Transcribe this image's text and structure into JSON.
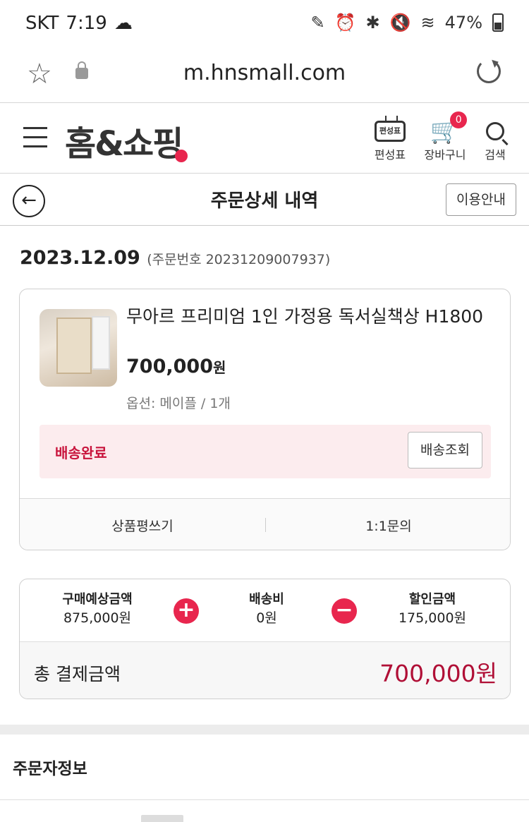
{
  "status_bar": {
    "carrier": "SKT",
    "time": "7:19",
    "battery": "47%"
  },
  "browser": {
    "url": "m.hnsmall.com"
  },
  "header": {
    "logo": "홈&쇼핑",
    "schedule_label": "편성표",
    "schedule_icon_text": "편성표",
    "cart_label": "장바구니",
    "cart_count": "0",
    "search_label": "검색"
  },
  "page": {
    "title": "주문상세 내역",
    "guide_button": "이용안내"
  },
  "order": {
    "date": "2023.12.09",
    "number_text": "(주문번호 20231209007937)"
  },
  "product": {
    "name": "무아르 프리미엄 1인 가정용 독서실책상 H1800",
    "price": "700,000",
    "price_unit": "원",
    "option": "옵션: 메이플 / 1개",
    "delivery_status": "배송완료",
    "track_button": "배송조회",
    "review_button": "상품평쓰기",
    "inquiry_button": "1:1문의"
  },
  "summary": {
    "purchase_label": "구매예상금액",
    "purchase_value": "875,000원",
    "shipping_label": "배송비",
    "shipping_value": "0원",
    "discount_label": "할인금액",
    "discount_value": "175,000원",
    "total_label": "총 결제금액",
    "total_value": "700,000원",
    "plus": "+",
    "minus": "−"
  },
  "section": {
    "orderer_title": "주문자정보"
  },
  "colors": {
    "accent": "#e8264e",
    "total_red": "#b00f36",
    "delivery_bg": "#fcecee"
  }
}
